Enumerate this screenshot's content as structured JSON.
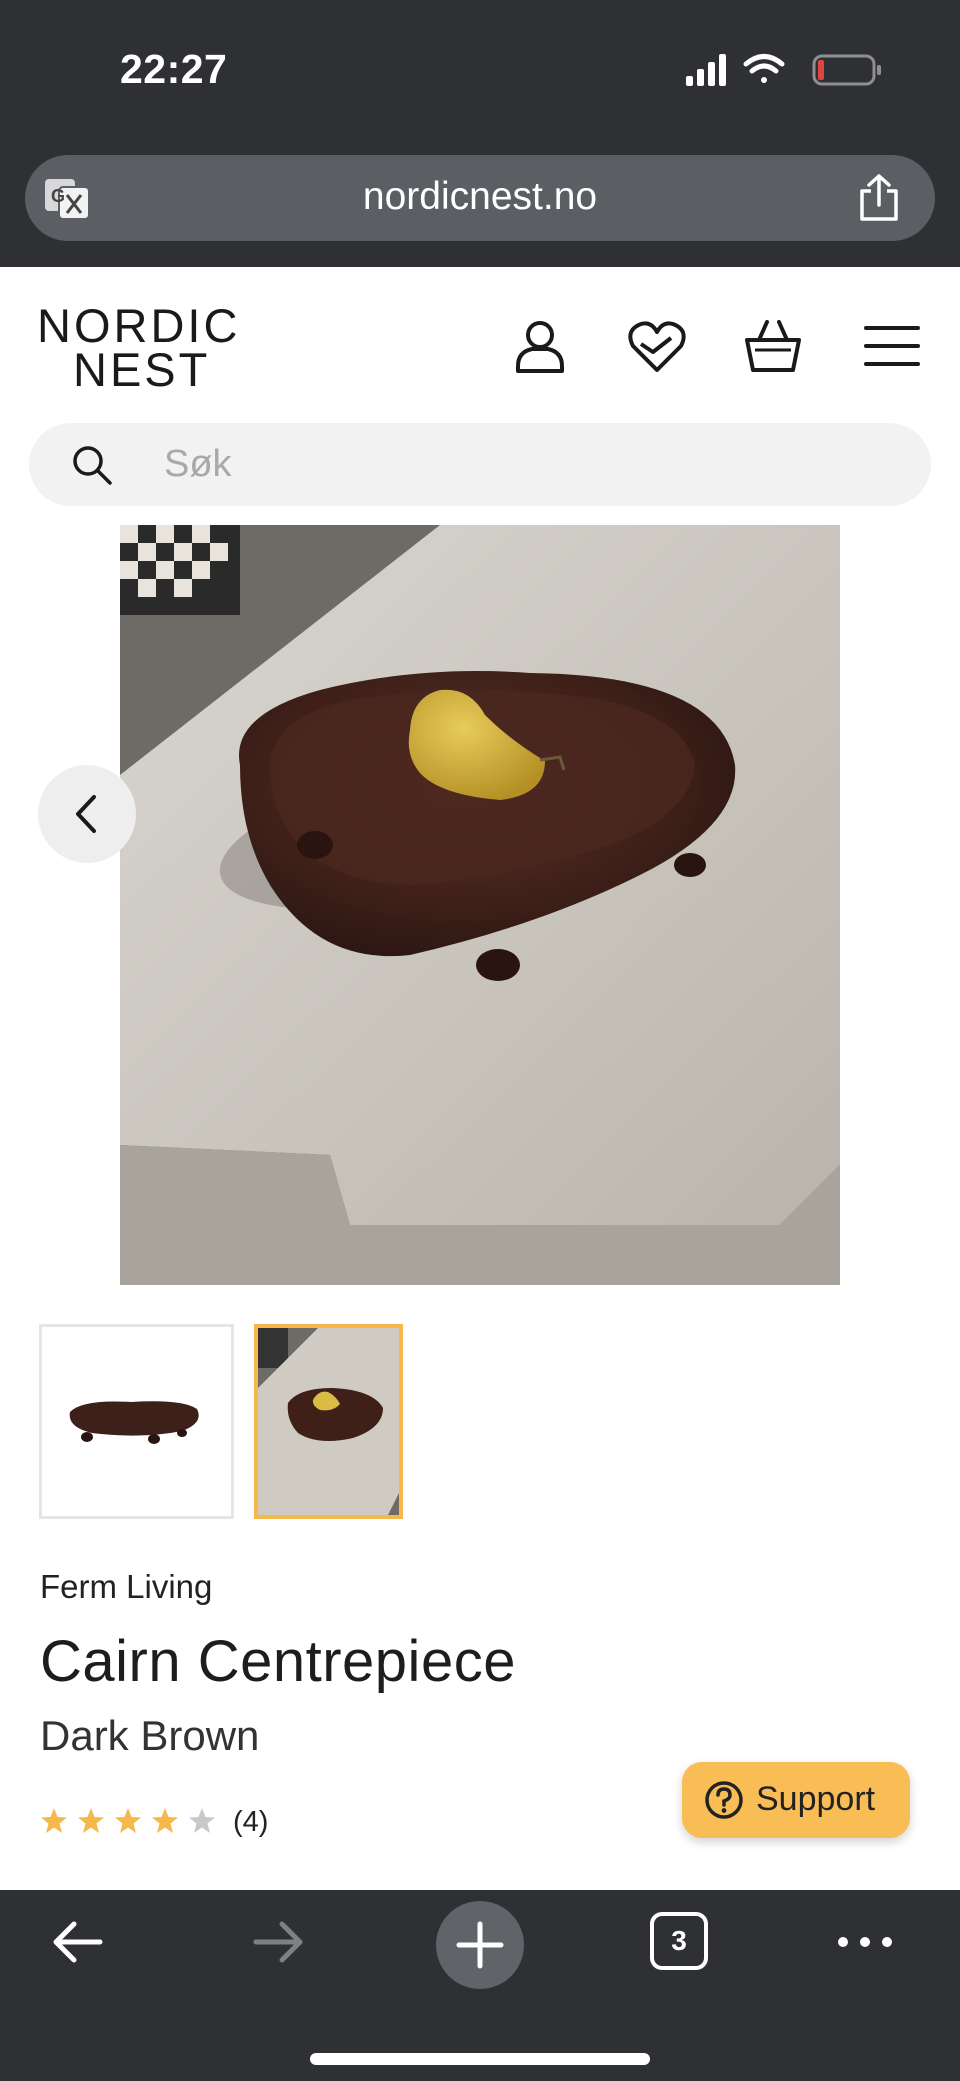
{
  "status_bar": {
    "time": "22:27",
    "battery_color": "#e0443e"
  },
  "browser": {
    "url": "nordicnest.no",
    "tab_count": "3"
  },
  "site": {
    "logo_line1": "NORDIC",
    "logo_line2": "NEST",
    "header_icons": [
      "account-icon",
      "wishlist-icon",
      "basket-icon",
      "menu-icon"
    ]
  },
  "search": {
    "placeholder": "Søk"
  },
  "product": {
    "brand": "Ferm Living",
    "name": "Cairn Centrepiece",
    "variant": "Dark Brown",
    "rating": 4,
    "rating_max": 5,
    "review_count": "(4)",
    "images_count": 2,
    "selected_image": 2
  },
  "support": {
    "label": "Support"
  },
  "colors": {
    "chrome": "#2e3034",
    "accent": "#f9bd55",
    "star": "#f5b84a",
    "star_empty": "#c8c8c8"
  }
}
